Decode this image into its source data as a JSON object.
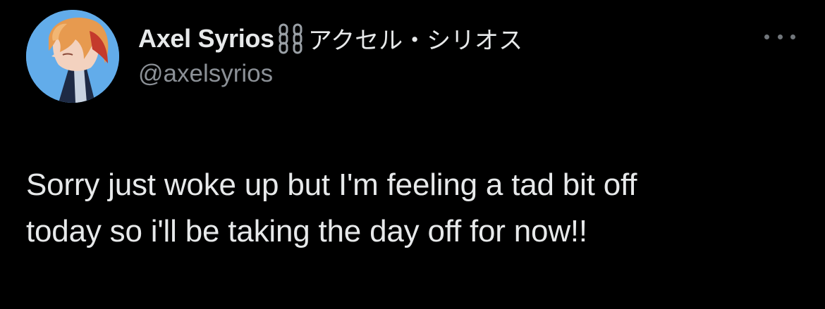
{
  "tweet": {
    "author": {
      "display_name": "Axel Syrios",
      "name_icon": "chain-links-icon",
      "jp_name": "アクセル・シリオス",
      "handle": "@axelsyrios",
      "avatar_icon": "profile-avatar"
    },
    "more_icon": "more-options-icon",
    "text_lines": [
      "Sorry just woke up but I'm feeling a tad bit off",
      "today so i'll be taking the day off for now!!"
    ]
  },
  "colors": {
    "background": "#000000",
    "primary_text": "#e7e9ea",
    "secondary_text": "#71767b",
    "avatar_bg": "#5aa7e6"
  }
}
